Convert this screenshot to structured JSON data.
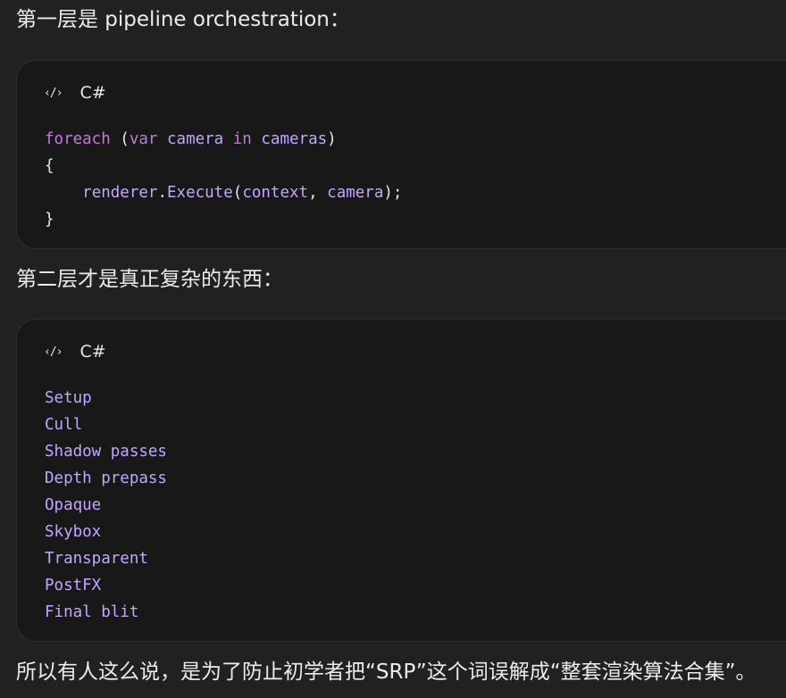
{
  "para1": "第一层是 pipeline orchestration：",
  "code1": {
    "icon": "code-icon",
    "lang": "C#",
    "l1_kw": "foreach",
    "l1_p1": " (",
    "l1_kw2": "var",
    "l1_sp": " ",
    "l1_id1": "camera",
    "l1_sp2": " ",
    "l1_kw3": "in",
    "l1_sp3": " ",
    "l1_id2": "cameras",
    "l1_p2": ")",
    "l2": "{",
    "l3_indent": "    ",
    "l3_id1": "renderer",
    "l3_dot": ".",
    "l3_id2": "Execute",
    "l3_p1": "(",
    "l3_id3": "context",
    "l3_comma": ", ",
    "l3_id4": "camera",
    "l3_p2": ");",
    "l4": "}"
  },
  "para2": "第二层才是真正复杂的东西：",
  "code2": {
    "icon": "code-icon",
    "lang": "C#",
    "lines": [
      "Setup",
      "Cull",
      "Shadow passes",
      "Depth prepass",
      "Opaque",
      "Skybox",
      "Transparent",
      "PostFX",
      "Final blit"
    ]
  },
  "para3": "所以有人这么说，是为了防止初学者把“SRP”这个词误解成“整套渲染算法合集”。"
}
